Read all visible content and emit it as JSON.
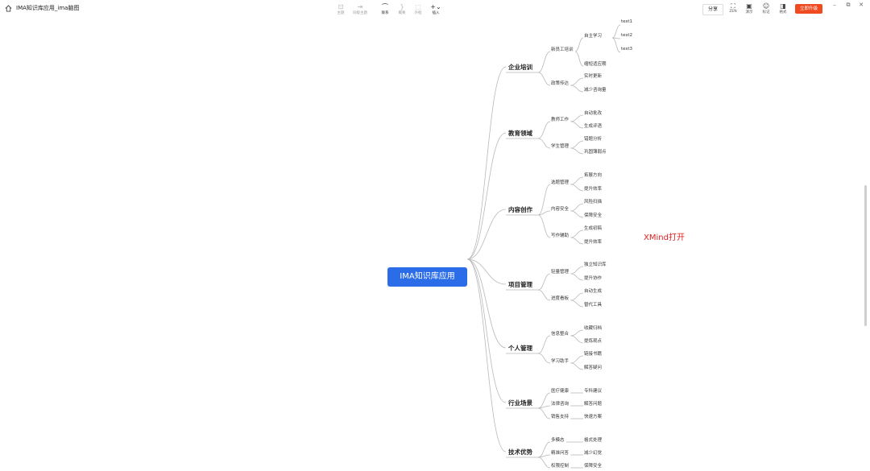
{
  "app": {
    "title": "IMA知识库应用_ima脑图",
    "toolbar": {
      "subtopic": "主题",
      "sibling": "同级主题",
      "link": "联系",
      "summary": "概要",
      "frame": "外框",
      "insert": "插入"
    },
    "right": {
      "share": "分享",
      "zen": "ZEN",
      "present": "演示",
      "mark": "标记",
      "format": "格式",
      "upgrade": "立即升级"
    }
  },
  "mindmap": {
    "root": "IMA知识库应用",
    "branches": [
      {
        "label": "企业培训",
        "children": [
          {
            "label": "新员工培训",
            "children": [
              {
                "label": "自主学习",
                "children": [
                  "test1",
                  "test2",
                  "test3"
                ]
              },
              {
                "label": "缩短适应期",
                "children": []
              }
            ]
          },
          {
            "label": "政策传达",
            "children": [
              "实时更新",
              "减少咨询量"
            ]
          }
        ]
      },
      {
        "label": "教育领域",
        "children": [
          {
            "label": "教师工作",
            "children": [
              "自动批改",
              "生成评语"
            ]
          },
          {
            "label": "学生管理",
            "children": [
              "错题分析",
              "巩固薄弱点"
            ]
          }
        ]
      },
      {
        "label": "内容创作",
        "children": [
          {
            "label": "选题管理",
            "children": [
              "拓展方向",
              "提升效率"
            ]
          },
          {
            "label": "内容安全",
            "children": [
              "风险扫描",
              "保障安全"
            ]
          },
          {
            "label": "写作辅助",
            "children": [
              "生成初稿",
              "提升效率"
            ]
          }
        ]
      },
      {
        "label": "项目管理",
        "children": [
          {
            "label": "轻量管理",
            "children": [
              "独立知识库",
              "提升协作"
            ]
          },
          {
            "label": "进度看板",
            "children": [
              "自动生成",
              "替代工具"
            ]
          }
        ]
      },
      {
        "label": "个人管理",
        "children": [
          {
            "label": "信息整合",
            "children": [
              "收藏归档",
              "提炼观点"
            ]
          },
          {
            "label": "学习助手",
            "children": [
              "链接书籍",
              "解答疑问"
            ]
          }
        ]
      },
      {
        "label": "行业场景",
        "children": [
          {
            "label": "医疗健康",
            "children": [
              "专科建议"
            ]
          },
          {
            "label": "法律咨询",
            "children": [
              "解答问题"
            ]
          },
          {
            "label": "销售支持",
            "children": [
              "快速方案"
            ]
          }
        ]
      },
      {
        "label": "技术优势",
        "children": [
          {
            "label": "多模态",
            "children": [
              "格式处理"
            ]
          },
          {
            "label": "精准问答",
            "children": [
              "减少幻觉"
            ]
          },
          {
            "label": "权限控制",
            "children": [
              "保障安全"
            ]
          }
        ]
      }
    ],
    "annotation": "XMind打开"
  }
}
